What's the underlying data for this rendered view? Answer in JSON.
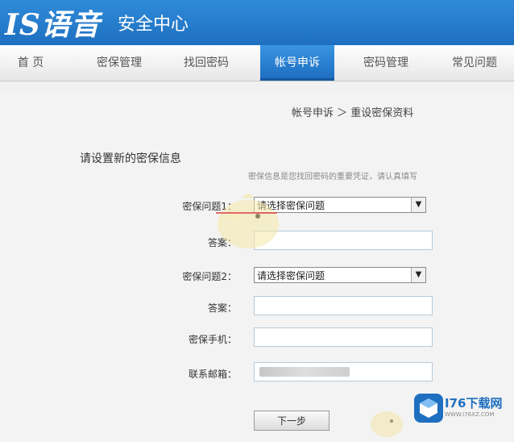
{
  "header": {
    "logo": "IS语音",
    "title": "安全中心"
  },
  "nav": {
    "items": [
      {
        "label": "首 页"
      },
      {
        "label": "密保管理"
      },
      {
        "label": "找回密码"
      },
      {
        "label": "帐号申诉"
      },
      {
        "label": "密码管理"
      },
      {
        "label": "常见问题"
      }
    ],
    "active_index": 3
  },
  "breadcrumb": "帐号申诉 ＞ 重设密保资料",
  "form": {
    "title": "请设置新的密保信息",
    "hint": "密保信息是您找回密码的重要凭证，请认真填写",
    "q1_label": "密保问题1：",
    "q1_value": "请选择密保问题",
    "a1_label": "答案：",
    "q2_label": "密保问题2：",
    "q2_value": "请选择密保问题",
    "a2_label": "答案：",
    "phone_label": "密保手机：",
    "email_label": "联系邮箱："
  },
  "next_button": "下一步",
  "watermark": {
    "text": "I76下载网",
    "sub": "WWW.I76XZ.COM"
  },
  "colors": {
    "header_blue": "#2a82d2",
    "active_tab": "#2a82d2"
  }
}
